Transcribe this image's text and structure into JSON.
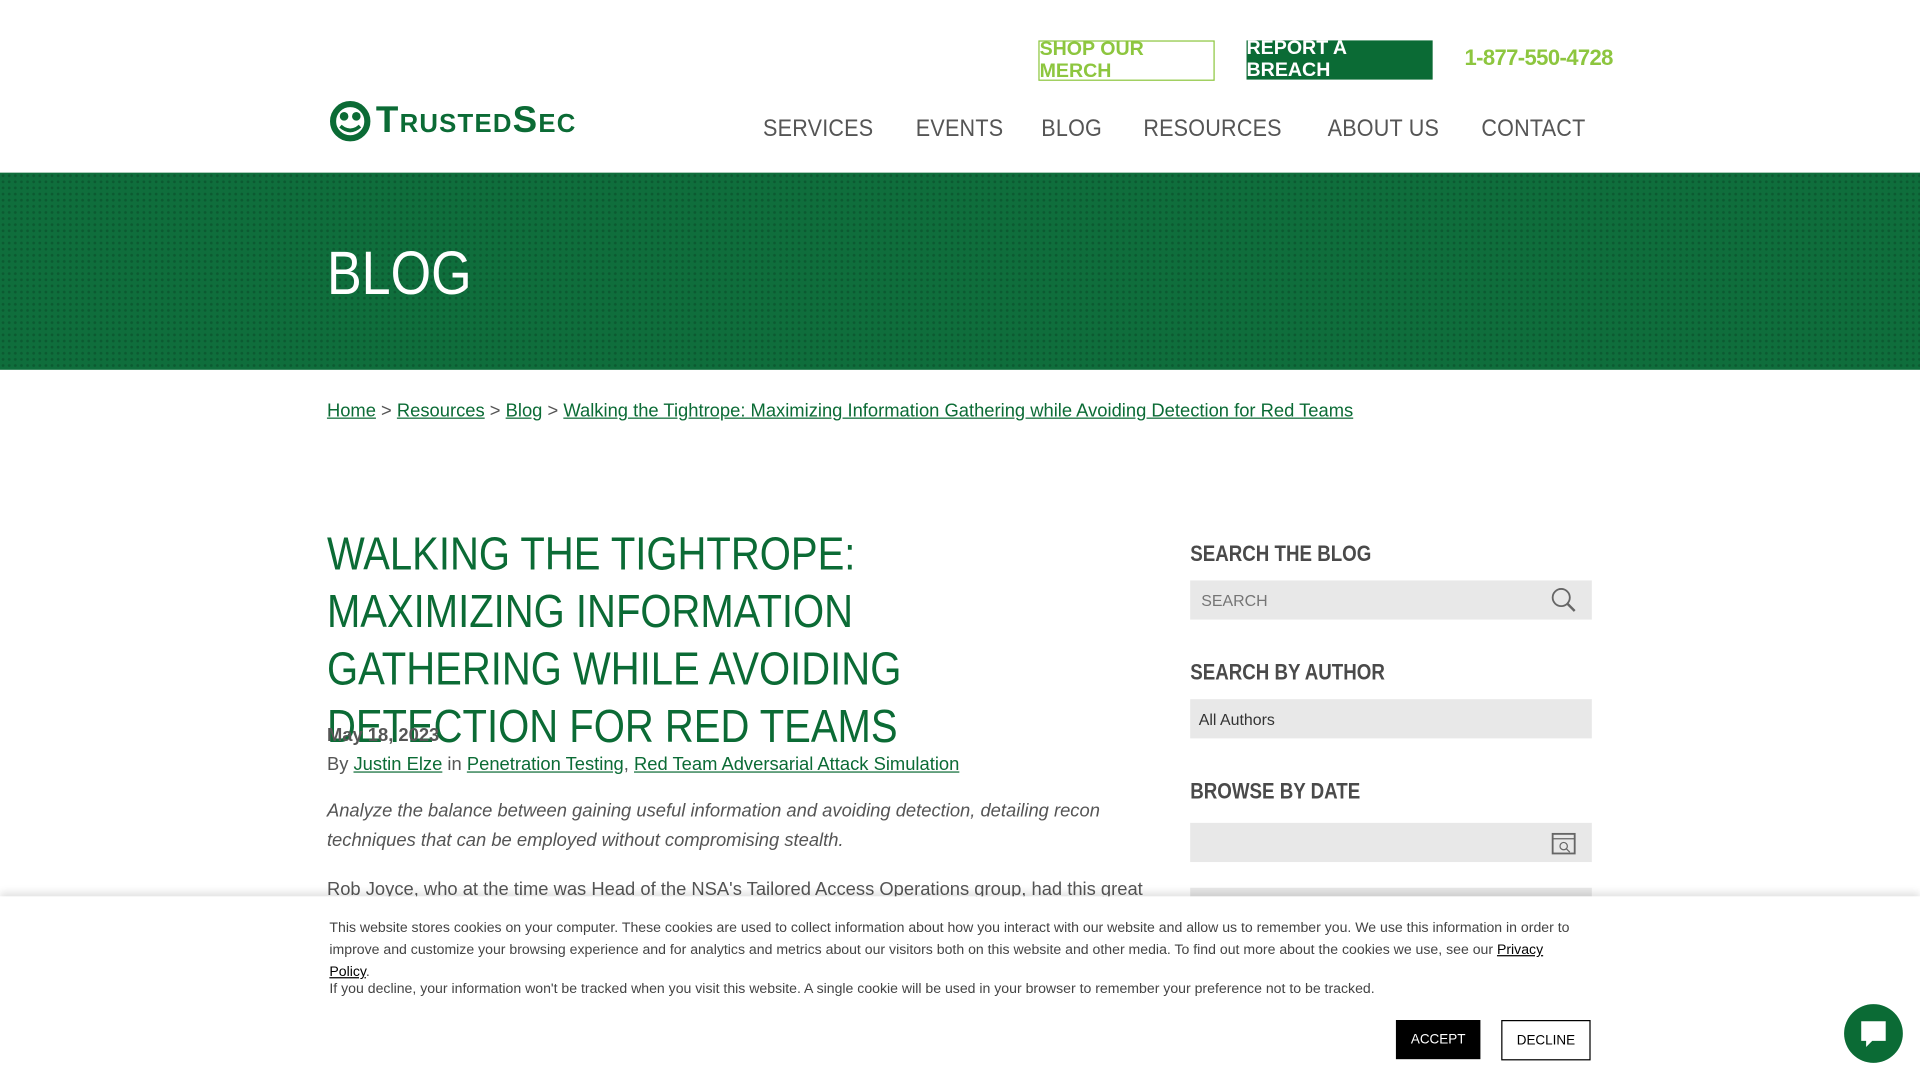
{
  "header": {
    "shop_label": "SHOP OUR MERCH",
    "breach_label": "REPORT A BREACH",
    "phone": "1-877-550-4728",
    "logo_text": "TrustedSec",
    "nav": [
      "SERVICES",
      "EVENTS",
      "BLOG",
      "RESOURCES",
      "ABOUT US",
      "CONTACT"
    ]
  },
  "hero": {
    "title": "BLOG"
  },
  "breadcrumb": {
    "items": [
      "Home",
      "Resources",
      "Blog",
      "Walking the Tightrope: Maximizing Information Gathering while Avoiding Detection for Red Teams"
    ],
    "separator": ">"
  },
  "article": {
    "title": "WALKING THE TIGHTROPE: MAXIMIZING INFORMATION GATHERING WHILE AVOIDING DETECTION FOR RED TEAMS",
    "date": "May 18, 2023",
    "by": "By",
    "author": "Justin Elze",
    "in": "in",
    "categories": [
      "Penetration Testing",
      "Red Team Adversarial Attack Simulation"
    ],
    "excerpt": "Analyze the balance between gaining useful information and avoiding detection, detailing recon techniques that can be employed without compromising stealth.",
    "paragraph_start": "Rob Joyce, who at the time was Head of the NSA's Tailored Access Operations group, had this great"
  },
  "sidebar": {
    "search_heading": "SEARCH THE BLOG",
    "search_placeholder": "SEARCH",
    "author_heading": "SEARCH BY AUTHOR",
    "author_value": "All Authors",
    "date_heading": "BROWSE BY DATE"
  },
  "cookie": {
    "text1": "This website stores cookies on your computer. These cookies are used to collect information about how you interact with our website and allow us to remember you. We use this information in order to improve and customize your browsing experience and for analytics and metrics about our visitors both on this website and other media. To find out more about the cookies we use, see our",
    "privacy_link": "Privacy Policy",
    "text2": "If you decline, your information won't be tracked when you visit this website. A single cookie will be used in your browser to remember your preference not to be tracked.",
    "accept": "ACCEPT",
    "decline": "DECLINE"
  },
  "colors": {
    "brand_green": "#0b6b35",
    "lime": "#8dc63f"
  }
}
